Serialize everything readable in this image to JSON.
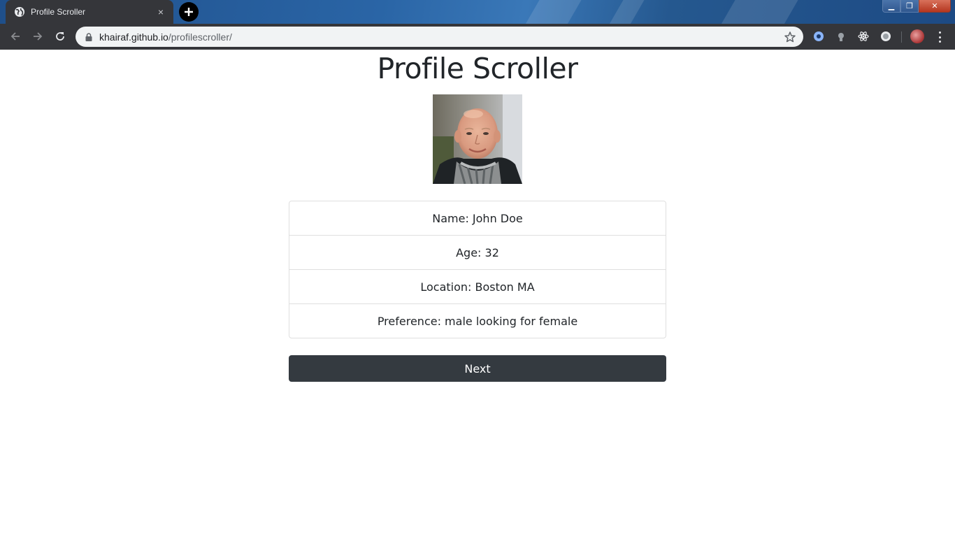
{
  "browser": {
    "tab_title": "Profile Scroller",
    "tab_close": "×",
    "url_domain": "khairaf.github.io",
    "url_path": "/profilescroller/",
    "window_controls": {
      "minimize": "▁",
      "maximize": "❐",
      "close": "✕"
    }
  },
  "page": {
    "title": "Profile Scroller",
    "photo_alt": "Profile photo",
    "profile": [
      {
        "label": "Name: John Doe"
      },
      {
        "label": "Age: 32"
      },
      {
        "label": "Location: Boston MA"
      },
      {
        "label": "Preference: male looking for female"
      }
    ],
    "next_label": "Next"
  },
  "colors": {
    "chrome_dark": "#35363a",
    "omnibox": "#f1f3f4",
    "button_dark": "#343a40",
    "text": "#212529"
  }
}
